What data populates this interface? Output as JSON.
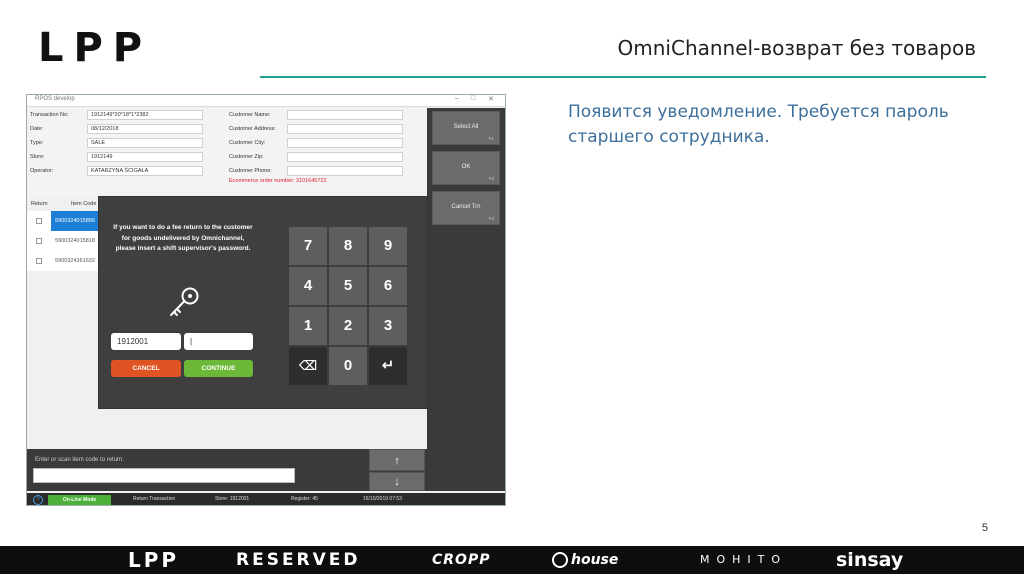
{
  "slide": {
    "logo": "LPP",
    "title": "OmniChannel-возврат без товаров",
    "note": "Появится уведомление. Требуется пароль старшего сотрудника.",
    "page_number": "5"
  },
  "footer_brands": [
    "LPP",
    "RESERVED",
    "CROPP",
    "house",
    "MOHITO",
    "sinsay"
  ],
  "app": {
    "window_title": "RPOS develop",
    "fields": {
      "transaction_no": {
        "label": "Transaction No:",
        "value": "1912149*20*18*1*2382"
      },
      "date": {
        "label": "Date:",
        "value": "08/12/2018"
      },
      "type": {
        "label": "Type:",
        "value": "SALE"
      },
      "store": {
        "label": "Store:",
        "value": "1912149"
      },
      "operator": {
        "label": "Operator:",
        "value": "KATARZYNA ŚCIGAŁA"
      },
      "customer_name": {
        "label": "Customer Name:",
        "value": ""
      },
      "customer_address": {
        "label": "Customer Address:",
        "value": ""
      },
      "customer_city": {
        "label": "Customer City:",
        "value": ""
      },
      "customer_zip": {
        "label": "Customer Zip:",
        "value": ""
      },
      "customer_phone": {
        "label": "Customer Phone:",
        "value": ""
      }
    },
    "ecommerce_order": "Ecommerce order number: 3101645722",
    "side_buttons": [
      {
        "label": "Select All",
        "key": "F1"
      },
      {
        "label": "OK",
        "key": "F2"
      },
      {
        "label": "Cancel Trn",
        "key": "F3"
      }
    ],
    "table": {
      "headers": [
        "Return",
        "Item Code"
      ],
      "rows": [
        "5900324015856",
        "5900324015818",
        "5900324361632"
      ]
    },
    "scan_placeholder": "Enter or scan item code to return.",
    "arrows": {
      "up": "↑",
      "down": "↓"
    },
    "status": {
      "help": "?",
      "mode": "On-Line Mode",
      "transaction": "Return Transaction",
      "store": "Store: 1912001",
      "register": "Register: 45",
      "datetime": "16/10/2019 07:53"
    }
  },
  "modal": {
    "message": "If you want to do a fee return to the customer for goods undelivered by Omnichannel, please insert a shift supervisor's password.",
    "user_value": "1912001",
    "password_value": "|",
    "cancel_label": "CANCEL",
    "continue_label": "CONTINUE",
    "keypad": [
      "7",
      "8",
      "9",
      "4",
      "5",
      "6",
      "1",
      "2",
      "3",
      "⌫",
      "0",
      "↵"
    ]
  },
  "colors": {
    "accent_rule": "#21a08f",
    "note_text": "#3d6f9c",
    "cancel": "#e05423",
    "continue": "#6cb838",
    "online": "#4caf39",
    "selected_row": "#1e7fd6"
  }
}
